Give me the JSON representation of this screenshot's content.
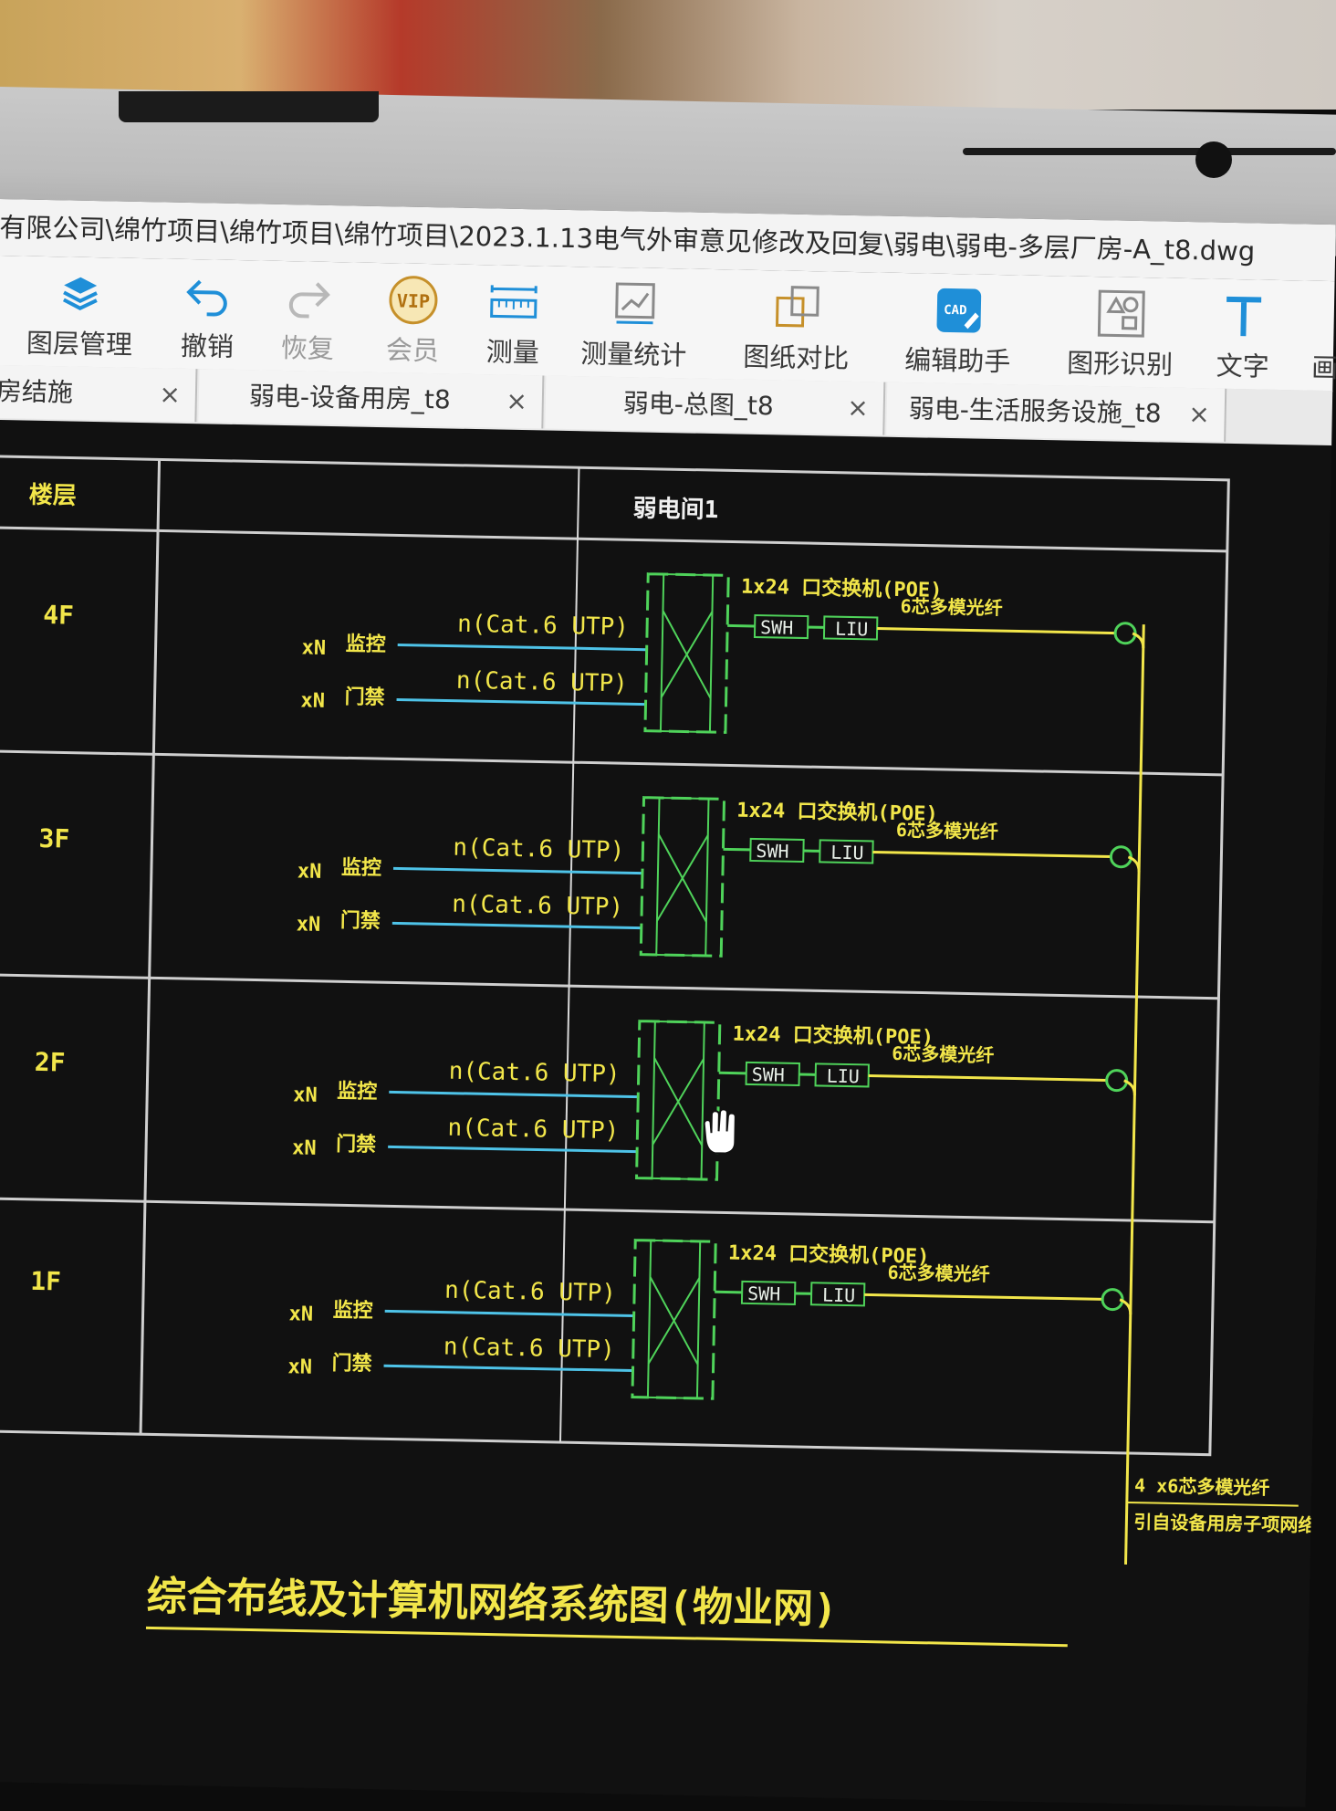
{
  "window": {
    "title": "有限公司\\绵竹项目\\绵竹项目\\绵竹项目\\2023.1.13电气外审意见修改及回复\\弱电\\弱电-多层厂房-A_t8.dwg"
  },
  "toolbar": {
    "items": [
      {
        "label": "图层管理",
        "icon": "layers-icon"
      },
      {
        "label": "撤销",
        "icon": "undo-icon"
      },
      {
        "label": "恢复",
        "icon": "redo-icon"
      },
      {
        "label": "会员",
        "icon": "vip-icon"
      },
      {
        "label": "测量",
        "icon": "ruler-icon"
      },
      {
        "label": "测量统计",
        "icon": "measure-stats-icon"
      },
      {
        "label": "图纸对比",
        "icon": "compare-icon"
      },
      {
        "label": "编辑助手",
        "icon": "cad-edit-icon"
      },
      {
        "label": "图形识别",
        "icon": "shape-recognition-icon"
      },
      {
        "label": "文字",
        "icon": "text-icon"
      },
      {
        "label": "画",
        "icon": "draw-icon"
      }
    ]
  },
  "tabs": [
    {
      "label": "房结施"
    },
    {
      "label": "弱电-设备用房_t8"
    },
    {
      "label": "弱电-总图_t8"
    },
    {
      "label": "弱电-生活服务设施_t8"
    }
  ],
  "drawing": {
    "header_floor": "楼层",
    "header_room": "弱电间1",
    "floors": [
      {
        "name": "4F"
      },
      {
        "name": "3F"
      },
      {
        "name": "2F"
      },
      {
        "name": "1F"
      }
    ],
    "cable_label": "n(Cat.6 UTP)",
    "multiplier": "xN",
    "system_monitor": "监控",
    "system_access": "门禁",
    "switch_label": "1x24 口交换机(POE)",
    "fiber_label": "6芯多模光纤",
    "swh": "SWH",
    "liu": "LIU",
    "riser_label_1": "4 x6芯多模光纤",
    "riser_label_2": "引自设备用房子项网络机房",
    "title": "综合布线及计算机网络系统图(物业网)"
  },
  "colors": {
    "yellow": "#f2e64a",
    "green": "#4fd35a",
    "cyan": "#4ec3e8",
    "grid": "#cfcfcf",
    "vip_gold": "#c6902a",
    "blue_icon": "#1f8fd8"
  }
}
